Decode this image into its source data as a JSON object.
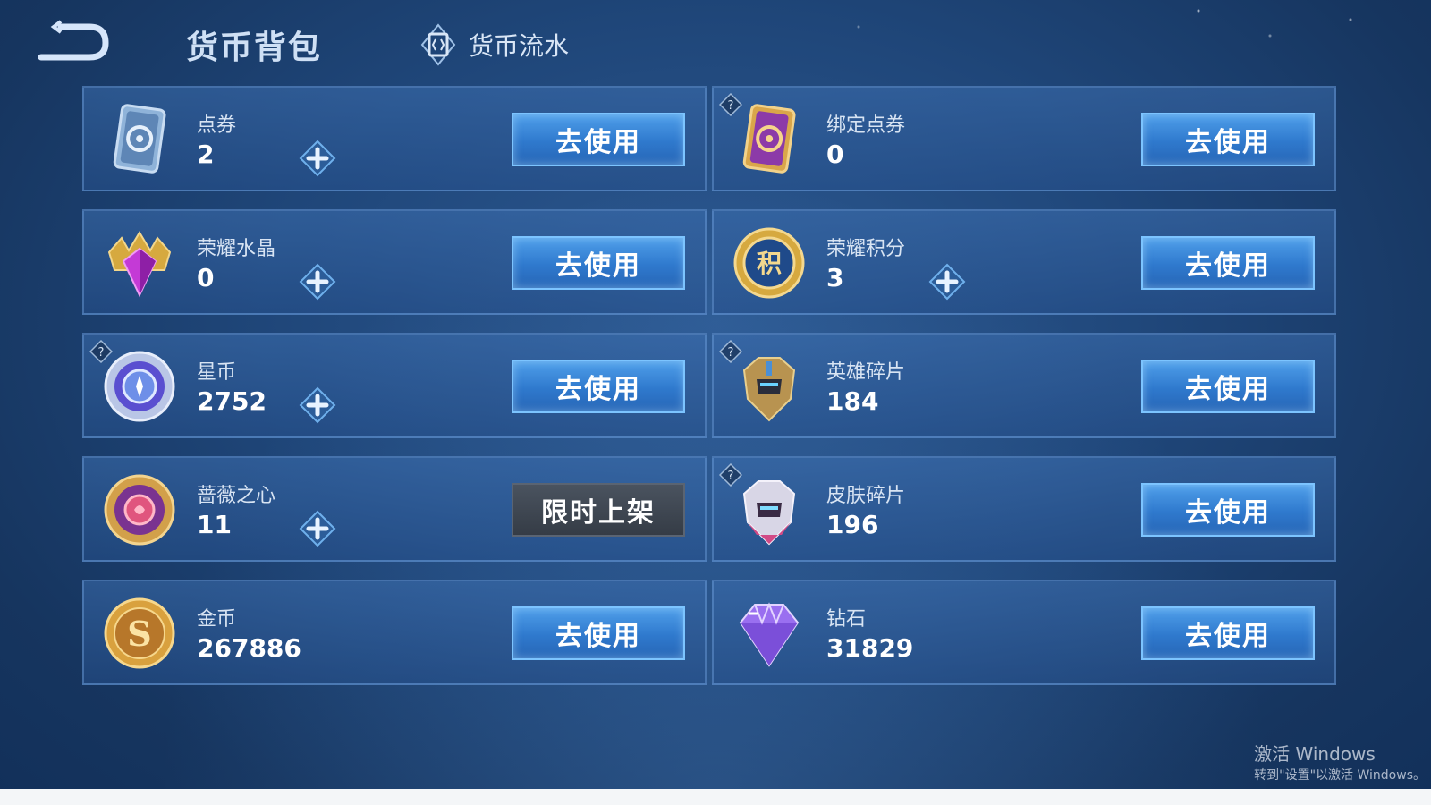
{
  "header": {
    "title": "货币背包",
    "flow_tab": "货币流水"
  },
  "accent_colors": {
    "use_button": "#2f79cd",
    "limited_button": "#3d4550",
    "card_border": "#6ea0dc"
  },
  "currencies": [
    {
      "name": "点券",
      "amount": "2",
      "icon": "ticket-blue-icon",
      "has_plus": true,
      "has_help": false,
      "button": "去使用",
      "button_type": "use"
    },
    {
      "name": "绑定点券",
      "amount": "0",
      "icon": "ticket-purple-icon",
      "has_plus": false,
      "has_help": true,
      "button": "去使用",
      "button_type": "use"
    },
    {
      "name": "荣耀水晶",
      "amount": "0",
      "icon": "glory-crystal-icon",
      "has_plus": true,
      "has_help": false,
      "button": "去使用",
      "button_type": "use"
    },
    {
      "name": "荣耀积分",
      "amount": "3",
      "icon": "glory-points-icon",
      "has_plus": true,
      "has_help": false,
      "button": "去使用",
      "button_type": "use"
    },
    {
      "name": "星币",
      "amount": "2752",
      "icon": "star-coin-icon",
      "has_plus": true,
      "has_help": true,
      "button": "去使用",
      "button_type": "use"
    },
    {
      "name": "英雄碎片",
      "amount": "184",
      "icon": "hero-shard-icon",
      "has_plus": false,
      "has_help": true,
      "button": "去使用",
      "button_type": "use"
    },
    {
      "name": "蔷薇之心",
      "amount": "11",
      "icon": "rose-heart-icon",
      "has_plus": true,
      "has_help": false,
      "button": "限时上架",
      "button_type": "limited"
    },
    {
      "name": "皮肤碎片",
      "amount": "196",
      "icon": "skin-shard-icon",
      "has_plus": false,
      "has_help": true,
      "button": "去使用",
      "button_type": "use"
    },
    {
      "name": "金币",
      "amount": "267886",
      "icon": "gold-coin-icon",
      "has_plus": false,
      "has_help": false,
      "button": "去使用",
      "button_type": "use"
    },
    {
      "name": "钻石",
      "amount": "31829",
      "icon": "diamond-icon",
      "has_plus": false,
      "has_help": false,
      "button": "去使用",
      "button_type": "use"
    }
  ],
  "watermark": {
    "line1": "激活 Windows",
    "line2": "转到\"设置\"以激活 Windows。"
  }
}
